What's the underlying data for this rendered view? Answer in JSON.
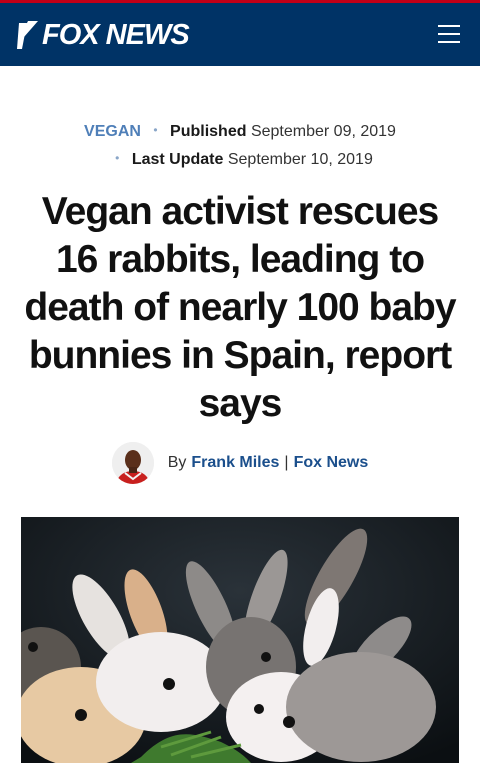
{
  "header": {
    "brand": "FOX NEWS",
    "menu_icon": "hamburger-menu-icon",
    "accent": "#003366",
    "top_line": "#c20017"
  },
  "article": {
    "category": "VEGAN",
    "published_label": "Published",
    "published_date": "September 09, 2019",
    "updated_label": "Last Update",
    "updated_date": "September 10, 2019",
    "headline": "Vegan activist rescues 16 rabbits, leading to death of nearly 100 baby bunnies in Spain, report says",
    "byline_prefix": "By",
    "author": "Frank Miles",
    "separator": "|",
    "outlet": "Fox News"
  }
}
